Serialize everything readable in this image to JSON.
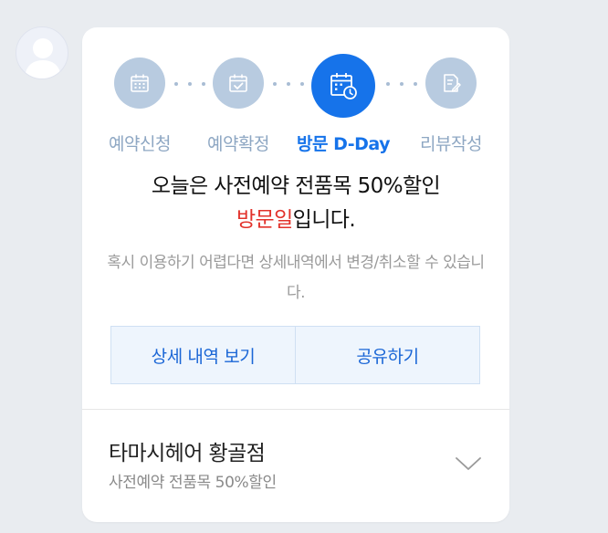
{
  "steps": [
    {
      "label": "예약신청",
      "icon": "calendar-grid-icon",
      "active": false
    },
    {
      "label": "예약확정",
      "icon": "calendar-check-icon",
      "active": false
    },
    {
      "label": "방문 D-Day",
      "icon": "calendar-clock-icon",
      "active": true
    },
    {
      "label": "리뷰작성",
      "icon": "review-pen-icon",
      "active": false
    }
  ],
  "message": {
    "line1": "오늘은 사전예약 전품목 50%할인",
    "highlight": "방문일",
    "line2_suffix": "입니다.",
    "subtext": "혹시 이용하기 어렵다면 상세내역에서 변경/취소할 수 있습니다."
  },
  "buttons": {
    "details": "상세 내역 보기",
    "share": "공유하기"
  },
  "store": {
    "name": "타마시헤어 황골점",
    "description": "사전예약 전품목 50%할인"
  },
  "colors": {
    "accent": "#1673ea",
    "highlight": "#e2322b",
    "inactive_step": "#b8cbe0",
    "inactive_label": "#8ea7c3"
  }
}
